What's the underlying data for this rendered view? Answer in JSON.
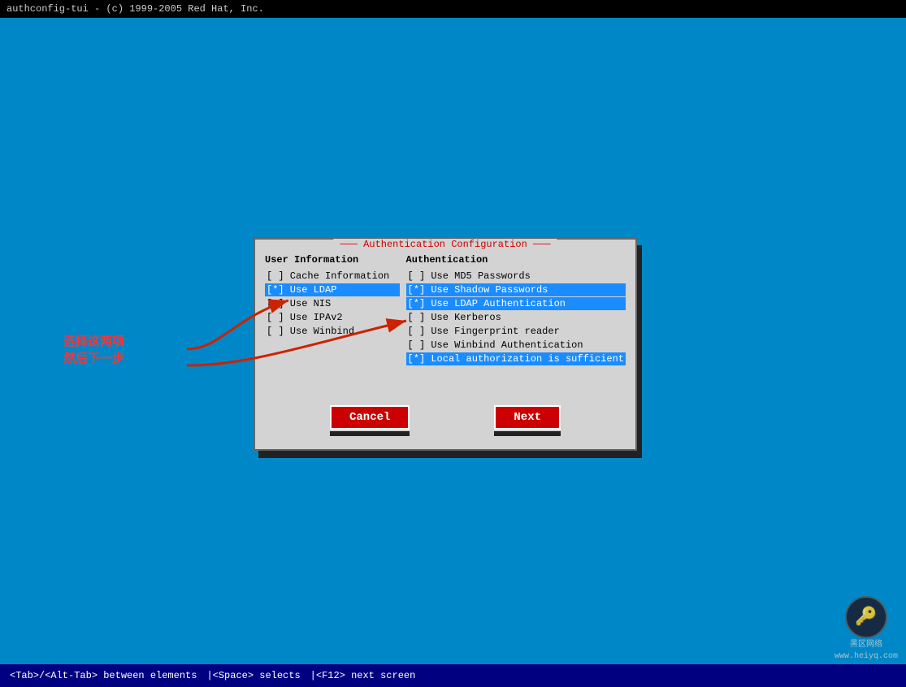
{
  "topbar": {
    "text": "authconfig-tui - (c) 1999-2005 Red Hat, Inc."
  },
  "bottombar": {
    "tab_hint": "<Tab>/<Alt-Tab> between elements",
    "space_hint": "<Space> selects",
    "f12_hint": "<F12> next screen"
  },
  "annotation": {
    "line1": "选择这两项",
    "line2": "然后下一步"
  },
  "dialog": {
    "title": "Authentication Configuration",
    "user_info": {
      "heading": "User Information",
      "items": [
        {
          "label": "[ ] Cache Information",
          "highlighted": false
        },
        {
          "label": "[*] Use LDAP",
          "highlighted": true
        },
        {
          "label": "[ ] Use NIS",
          "highlighted": false
        },
        {
          "label": "[ ] Use IPAv2",
          "highlighted": false
        },
        {
          "label": "[ ] Use Winbind",
          "highlighted": false
        }
      ]
    },
    "authentication": {
      "heading": "Authentication",
      "items": [
        {
          "label": "[ ] Use MD5 Passwords",
          "highlighted": false
        },
        {
          "label": "[*] Use Shadow Passwords",
          "highlighted": true
        },
        {
          "label": "[*] Use LDAP Authentication",
          "highlighted": true
        },
        {
          "label": "[ ] Use Kerberos",
          "highlighted": false
        },
        {
          "label": "[ ] Use Fingerprint reader",
          "highlighted": false
        },
        {
          "label": "[ ] Use Winbind Authentication",
          "highlighted": false
        },
        {
          "label": "[*] Local authorization is sufficient",
          "highlighted": true
        }
      ]
    },
    "buttons": {
      "cancel": "Cancel",
      "next": "Next"
    }
  },
  "watermark": {
    "icon": "🔑",
    "line1": "黑区网络",
    "line2": "www.heiyq.com"
  }
}
